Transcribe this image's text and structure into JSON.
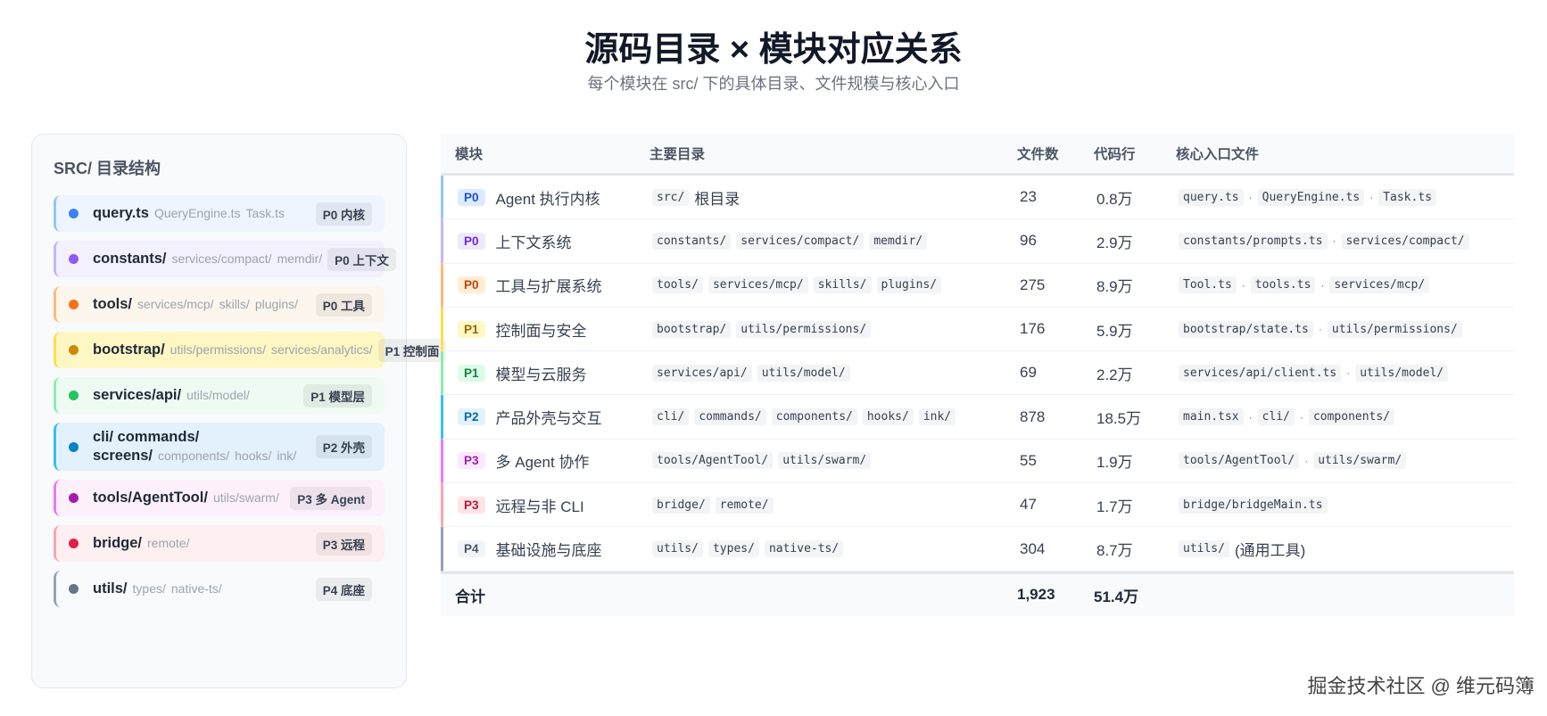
{
  "header": {
    "title": "源码目录 × 模块对应关系",
    "subtitle": "每个模块在 src/ 下的具体目录、文件规模与核心入口"
  },
  "panel": {
    "title": "SRC/ 目录结构",
    "items": [
      {
        "main": "query.ts",
        "subs": [
          "QueryEngine.ts",
          "Task.ts"
        ],
        "badge": "P0 内核",
        "color": "#3b82f6",
        "border": "#93c5fd",
        "bg": "#eef5fe"
      },
      {
        "main": "constants/",
        "subs": [
          "services/compact/",
          "memdir/"
        ],
        "badge": "P0 上下文",
        "color": "#8b5cf6",
        "border": "#c4b5fd",
        "bg": "#f3f1fd"
      },
      {
        "main": "tools/",
        "subs": [
          "services/mcp/",
          "skills/",
          "plugins/"
        ],
        "badge": "P0 工具",
        "color": "#f97316",
        "border": "#fdba74",
        "bg": "#fdf6ec"
      },
      {
        "main": "bootstrap/",
        "subs": [
          "utils/permissions/",
          "services/analytics/"
        ],
        "badge": "P1 控制面",
        "color": "#ca8a04",
        "border": "#fde047",
        "bg": "#fef6c3"
      },
      {
        "main": "services/api/",
        "subs": [
          "utils/model/"
        ],
        "badge": "P1 模型层",
        "color": "#22c55e",
        "border": "#86efac",
        "bg": "#eefaf2"
      },
      {
        "main": "cli/  commands/  screens/",
        "subs": [
          "components/",
          "hooks/",
          "ink/"
        ],
        "badge": "P2 外壳",
        "color": "#0284c7",
        "border": "#38bdf8",
        "bg": "#e3f1fd"
      },
      {
        "main": "tools/AgentTool/",
        "subs": [
          "utils/swarm/"
        ],
        "badge": "P3 多 Agent",
        "color": "#a21caf",
        "border": "#e879f9",
        "bg": "#fcf1fb"
      },
      {
        "main": "bridge/",
        "subs": [
          "remote/"
        ],
        "badge": "P3 远程",
        "color": "#e11d48",
        "border": "#fda4af",
        "bg": "#fef0f0"
      },
      {
        "main": "utils/",
        "subs": [
          "types/",
          "native-ts/"
        ],
        "badge": "P4 底座",
        "color": "#64748b",
        "border": "#94a3b8",
        "bg": "#f8fafc"
      }
    ]
  },
  "table": {
    "headers": [
      "模块",
      "主要目录",
      "文件数",
      "代码行",
      "核心入口文件"
    ],
    "rows": [
      {
        "priority": "P0",
        "module": "Agent 执行内核",
        "dirs": [
          "src/"
        ],
        "dir_note": "根目录",
        "files": "23",
        "lines": "0.8万",
        "entries": [
          "query.ts",
          "QueryEngine.ts",
          "Task.ts"
        ],
        "entry_note": "",
        "color": "#93c5fd",
        "badge_bg": "#dbeafe",
        "badge_fg": "#1d4ed8"
      },
      {
        "priority": "P0",
        "module": "上下文系统",
        "dirs": [
          "constants/",
          "services/compact/",
          "memdir/"
        ],
        "dir_note": "",
        "files": "96",
        "lines": "2.9万",
        "entries": [
          "constants/prompts.ts",
          "services/compact/"
        ],
        "entry_note": "",
        "color": "#c4b5fd",
        "badge_bg": "#ede9fe",
        "badge_fg": "#6d28d9"
      },
      {
        "priority": "P0",
        "module": "工具与扩展系统",
        "dirs": [
          "tools/",
          "services/mcp/",
          "skills/",
          "plugins/"
        ],
        "dir_note": "",
        "files": "275",
        "lines": "8.9万",
        "entries": [
          "Tool.ts",
          "tools.ts",
          "services/mcp/"
        ],
        "entry_note": "",
        "color": "#fdba74",
        "badge_bg": "#ffedd5",
        "badge_fg": "#c2410c"
      },
      {
        "priority": "P1",
        "module": "控制面与安全",
        "dirs": [
          "bootstrap/",
          "utils/permissions/"
        ],
        "dir_note": "",
        "files": "176",
        "lines": "5.9万",
        "entries": [
          "bootstrap/state.ts",
          "utils/permissions/"
        ],
        "entry_note": "",
        "color": "#fde047",
        "badge_bg": "#fef9c3",
        "badge_fg": "#a16207"
      },
      {
        "priority": "P1",
        "module": "模型与云服务",
        "dirs": [
          "services/api/",
          "utils/model/"
        ],
        "dir_note": "",
        "files": "69",
        "lines": "2.2万",
        "entries": [
          "services/api/client.ts",
          "utils/model/"
        ],
        "entry_note": "",
        "color": "#86efac",
        "badge_bg": "#dcfce7",
        "badge_fg": "#15803d"
      },
      {
        "priority": "P2",
        "module": "产品外壳与交互",
        "dirs": [
          "cli/",
          "commands/",
          "components/",
          "hooks/",
          "ink/"
        ],
        "dir_note": "",
        "files": "878",
        "lines": "18.5万",
        "entries": [
          "main.tsx",
          "cli/",
          "components/"
        ],
        "entry_note": "",
        "color": "#38bdf8",
        "badge_bg": "#e0f2fe",
        "badge_fg": "#0369a1"
      },
      {
        "priority": "P3",
        "module": "多 Agent 协作",
        "dirs": [
          "tools/AgentTool/",
          "utils/swarm/"
        ],
        "dir_note": "",
        "files": "55",
        "lines": "1.9万",
        "entries": [
          "tools/AgentTool/",
          "utils/swarm/"
        ],
        "entry_note": "",
        "color": "#e879f9",
        "badge_bg": "#fae8ff",
        "badge_fg": "#a21caf"
      },
      {
        "priority": "P3",
        "module": "远程与非 CLI",
        "dirs": [
          "bridge/",
          "remote/"
        ],
        "dir_note": "",
        "files": "47",
        "lines": "1.7万",
        "entries": [
          "bridge/bridgeMain.ts"
        ],
        "entry_note": "",
        "color": "#fda4af",
        "badge_bg": "#ffe4e6",
        "badge_fg": "#be123c"
      },
      {
        "priority": "P4",
        "module": "基础设施与底座",
        "dirs": [
          "utils/",
          "types/",
          "native-ts/"
        ],
        "dir_note": "",
        "files": "304",
        "lines": "8.7万",
        "entries": [
          "utils/"
        ],
        "entry_note": "(通用工具)",
        "color": "#94a3b8",
        "badge_bg": "#f1f5f9",
        "badge_fg": "#475569"
      }
    ],
    "total": {
      "label": "合计",
      "files": "1,923",
      "lines": "51.4万"
    },
    "separator": "·"
  },
  "watermark": "掘金技术社区 @ 维元码簿"
}
